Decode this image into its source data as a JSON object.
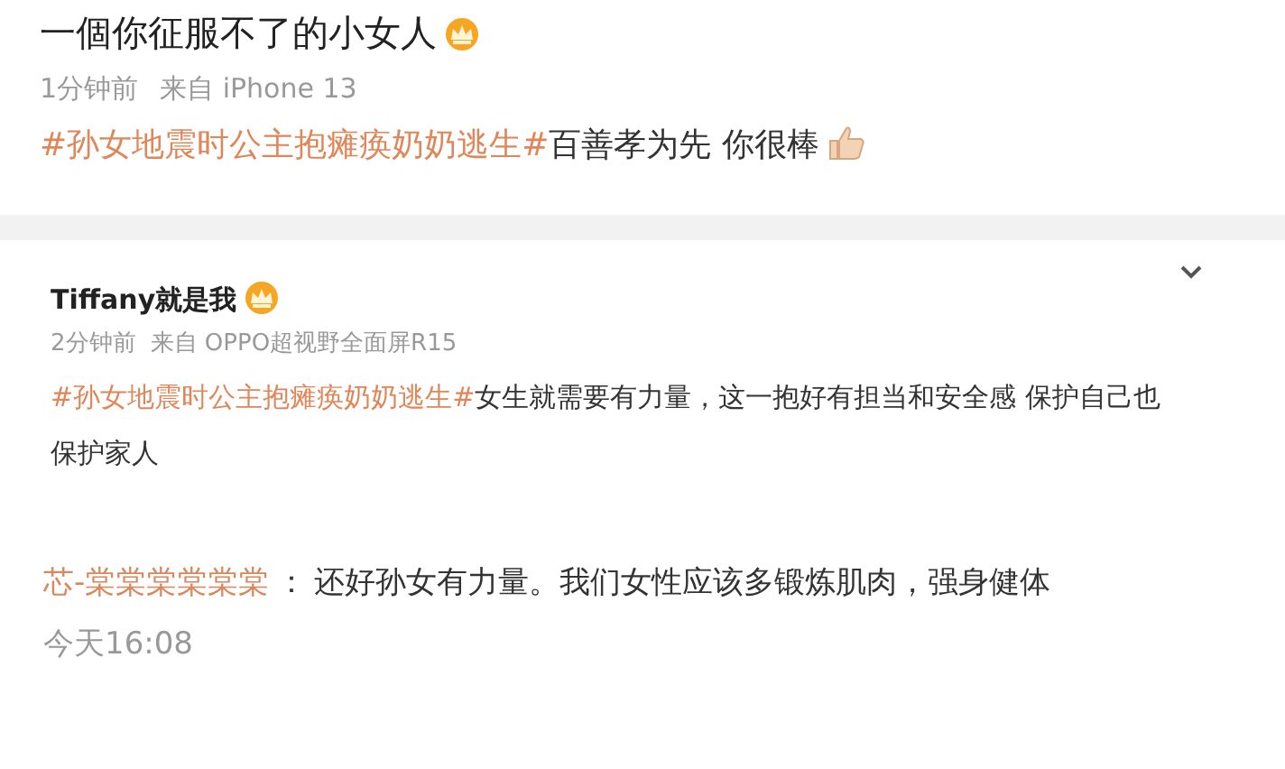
{
  "posts": [
    {
      "kind": "post",
      "author": "一個你征服不了的小女人",
      "badge": true,
      "time": "1分钟前",
      "source": "来自 iPhone 13",
      "hashtag": "#孙女地震时公主抱瘫痪奶奶逃生#",
      "text": "百善孝为先 你很棒",
      "thumbs_up": true
    },
    {
      "kind": "comment",
      "author": "Tiffany就是我",
      "badge": true,
      "time": "2分钟前",
      "source": "来自 OPPO超视野全面屏R15",
      "hashtag": "#孙女地震时公主抱瘫痪奶奶逃生#",
      "text": "女生就需要有力量，这一抱好有担当和安全感 保护自己也保护家人",
      "thumbs_up": false
    },
    {
      "kind": "reply",
      "author": "芯-棠棠棠棠棠棠",
      "separator": "：",
      "text": "还好孙女有力量。我们女性应该多锻炼肌肉，强身健体",
      "time": "今天16:08"
    }
  ]
}
